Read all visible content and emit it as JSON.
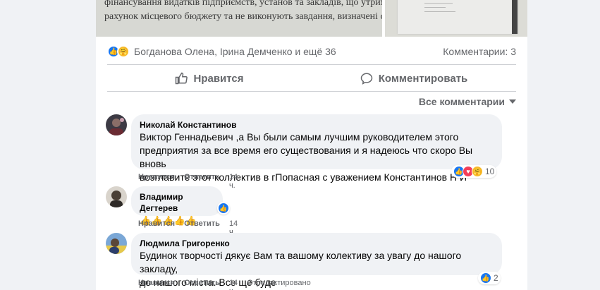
{
  "doc_image": {
    "lines": [
      "фінансування видатків підприємств, установ та закладів, що утримуються з",
      "рахунок місцевого бюджету та не виконують завдання, визначені статутним"
    ]
  },
  "post": {
    "reactors": "Богданова Олена, Ірина Демченко и ещё 36",
    "comments_count": "Комментарии: 3",
    "like_label": "Нравится",
    "comment_label": "Комментировать",
    "sort_label": "Все комментарии"
  },
  "comments": [
    {
      "author": "Николай Константинов",
      "lines": [
        "Виктор Геннадьевич ,а Вы были самым лучшим руководителем этого",
        "предприятия за все время его существования и я надеюсь что скоро Вы вновь",
        "возглавите этот коллектив в гПопасная с уважением Константинов Н И"
      ],
      "like_label": "Нравится",
      "reply_label": "Ответить",
      "time": "14 ч.",
      "reaction_count": "10"
    },
    {
      "author": "Владимир Дегтерев",
      "lines": [
        "👍👍👍👍👍"
      ],
      "like_label": "Нравится",
      "reply_label": "Ответить",
      "time": "14 ч."
    },
    {
      "author": "Людмила Григоренко",
      "lines": [
        "Будинок творчості дякує Вам та вашому колективу за увагу до нашого закладу,",
        "до нашого міста. Все ще буде"
      ],
      "like_label": "Нравится",
      "reply_label": "Ответить",
      "time": "14 ч.",
      "edited": "Отредактировано",
      "reaction_count": "2"
    }
  ],
  "colors": {
    "like_blue": "#1877f2",
    "love_red": "#f33e58",
    "care_yellow": "#f7b928",
    "bubble_bg": "#f0f2f5",
    "muted_text": "#65676b"
  }
}
